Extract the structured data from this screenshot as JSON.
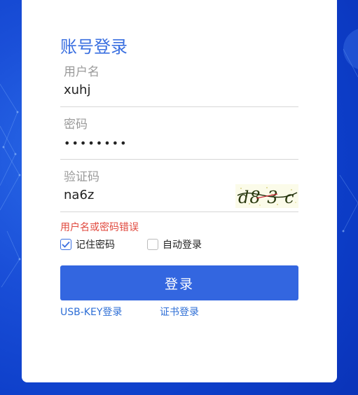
{
  "login": {
    "title": "账号登录",
    "username": {
      "label": "用户名",
      "value": "xuhj"
    },
    "password": {
      "label": "密码",
      "value": "••••••••"
    },
    "captcha": {
      "label": "验证码",
      "value": "na6z",
      "image_text": "d8 3 c"
    },
    "error": "用户名或密码错误",
    "remember": {
      "label": "记住密码",
      "checked": true
    },
    "auto_login": {
      "label": "自动登录",
      "checked": false
    },
    "submit_label": "登录",
    "alt_links": {
      "usb_key": "USB-KEY登录",
      "certificate": "证书登录"
    }
  },
  "colors": {
    "accent": "#3366e0",
    "title": "#3a6fe0",
    "error": "#e0483d",
    "link": "#2f6fd6",
    "background": "#1a4fd8"
  }
}
